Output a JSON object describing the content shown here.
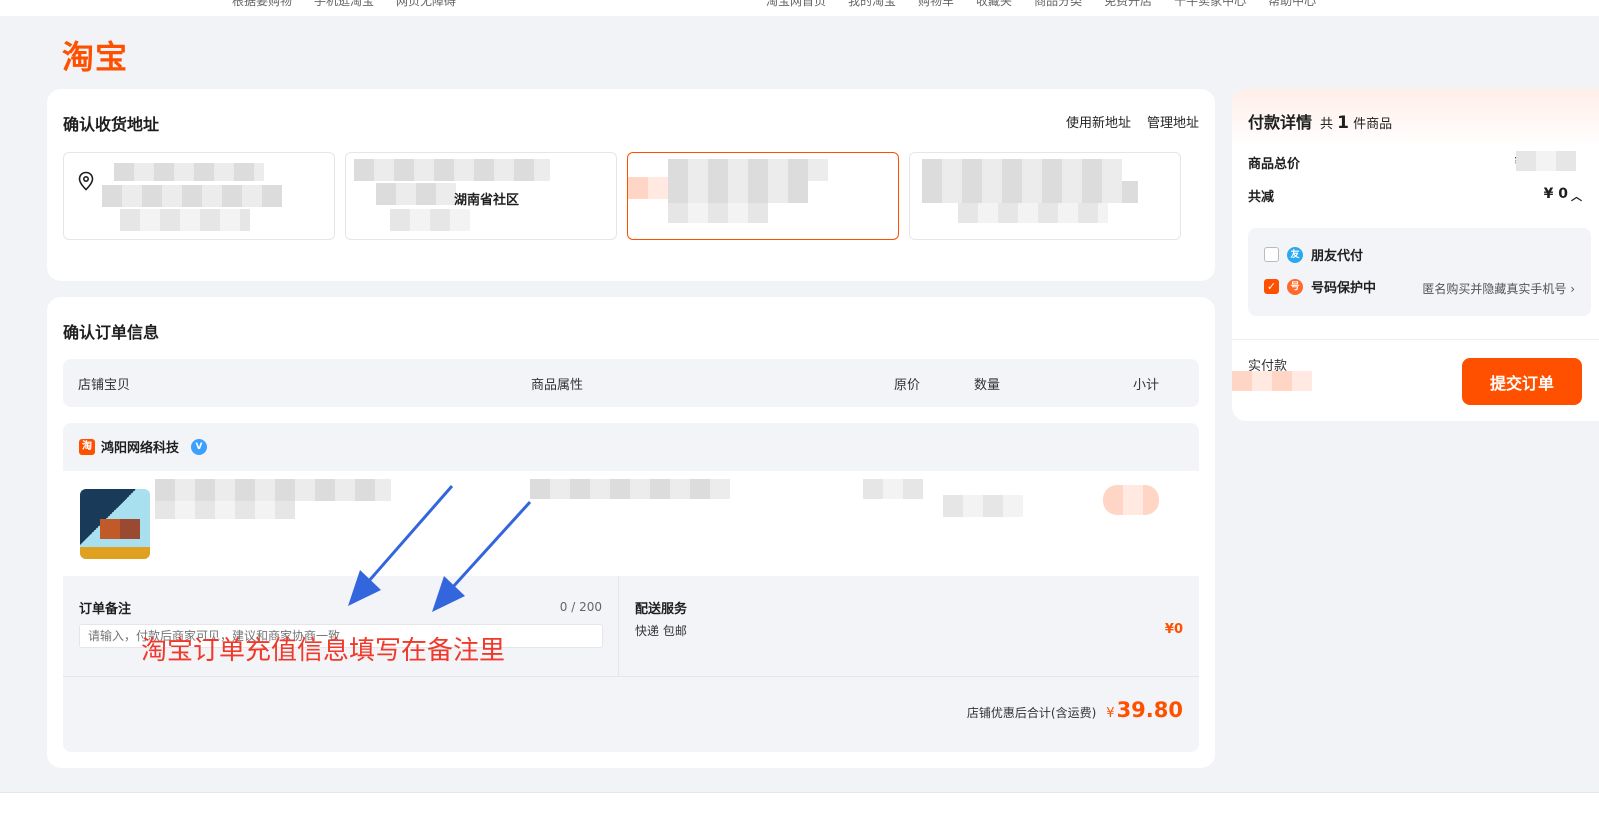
{
  "topnav": {
    "left": [
      "根据要购物",
      "手机逛淘宝",
      "网页无障碍"
    ],
    "right": [
      "淘宝网首页",
      "我的淘宝",
      "购物车",
      "收藏夹",
      "商品分类",
      "免费开店",
      "千牛卖家中心",
      "帮助中心"
    ]
  },
  "logo": "淘宝",
  "address": {
    "title": "确认收货地址",
    "use_new": "使用新地址",
    "manage": "管理地址",
    "visible_fragment": "湖南省社区"
  },
  "order": {
    "title": "确认订单信息",
    "columns": [
      "店铺宝贝",
      "商品属性",
      "原价",
      "数量",
      "小计"
    ],
    "shop_name": "鸿阳网络科技",
    "remark_label": "订单备注",
    "remark_count": "0 / 200",
    "remark_placeholder": "请输入，付款后商家可见，建议和商家协商一致",
    "delivery_label": "配送服务",
    "delivery_method": "快递 包邮",
    "delivery_price": "¥0",
    "total_label": "店铺优惠后合计(含运费)",
    "total_currency": "¥",
    "total_amount": "39.80"
  },
  "annotation": {
    "text": "淘宝订单充值信息填写在备注里",
    "color": "#f0392b",
    "arrow_color": "#3366dd"
  },
  "pay": {
    "title": "付款详情",
    "count_prefix": "共",
    "count": "1",
    "count_suffix": "件商品",
    "goods_total_label": "商品总价",
    "goods_total_currency": "¥",
    "discount_label": "共减",
    "discount_value": "¥ 0",
    "friend_pay": "朋友代付",
    "number_protect": "号码保护中",
    "number_protect_desc": "匿名购买并隐藏真实手机号",
    "paid_label": "实付款",
    "submit": "提交订单"
  },
  "colors": {
    "accent": "#ff5000",
    "background": "#f2f3f7"
  }
}
